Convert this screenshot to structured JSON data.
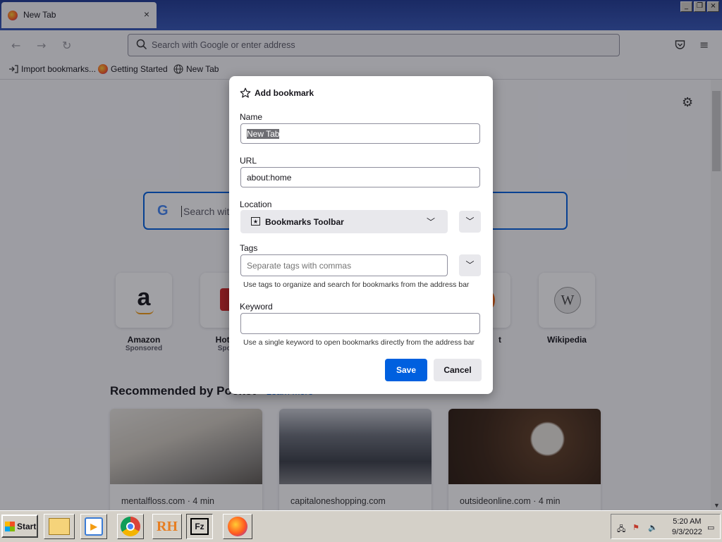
{
  "browser": {
    "tab_title": "New Tab",
    "tab_close": "×",
    "window_buttons": [
      "_",
      "❐",
      "×"
    ],
    "nav": {
      "back": "←",
      "forward": "→",
      "reload": "↻",
      "menu": "≡"
    },
    "urlbar_placeholder": "Search with Google or enter address",
    "bookmarks": [
      {
        "label": "Import bookmarks..."
      },
      {
        "label": "Getting Started"
      },
      {
        "label": "New Tab"
      }
    ]
  },
  "newtab": {
    "search_placeholder": "Search wit",
    "search_logo": "G",
    "tiles": [
      {
        "name": "Amazon",
        "sub": "Sponsored",
        "glyph": "a"
      },
      {
        "name": "Hotels",
        "sub": "Spons",
        "glyph": ""
      },
      {
        "name": "t",
        "sub": "",
        "glyph": ""
      },
      {
        "name": "Wikipedia",
        "sub": "",
        "glyph": "W"
      }
    ],
    "pocket_title": "Recommended by Pocket",
    "pocket_link": "Learn more",
    "cards": [
      {
        "source": "mentalfloss.com · 4 min"
      },
      {
        "source": "capitaloneshopping.com"
      },
      {
        "source": "outsideonline.com · 4 min"
      }
    ]
  },
  "dialog": {
    "title": "Add bookmark",
    "name_label": "Name",
    "name_value": "New Tab",
    "url_label": "URL",
    "url_value": "about:home",
    "location_label": "Location",
    "location_value": "Bookmarks Toolbar",
    "tags_label": "Tags",
    "tags_placeholder": "Separate tags with commas",
    "tags_hint": "Use tags to organize and search for bookmarks from the address bar",
    "keyword_label": "Keyword",
    "keyword_hint": "Use a single keyword to open bookmarks directly from the address bar",
    "save_label": "Save",
    "cancel_label": "Cancel"
  },
  "taskbar": {
    "start_label": "Start",
    "apps": [
      "explorer",
      "media",
      "chrome",
      "RH",
      "Fz",
      "firefox"
    ],
    "time": "5:20 AM",
    "date": "9/3/2022"
  },
  "colors": {
    "accent": "#0060df",
    "taskbar": "#d4d0c8",
    "titlebar": "#2c4aa8"
  }
}
